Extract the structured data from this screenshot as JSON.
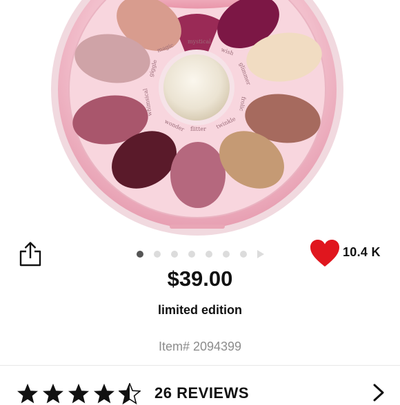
{
  "product": {
    "price": "$39.00",
    "edition": "limited edition",
    "item_number": "Item# 2094399",
    "likes": "10.4 K",
    "reviews": "26 REVIEWS",
    "rating": 4.5,
    "rating_max": 5
  },
  "gallery": {
    "total_images": 7,
    "current_index": 1
  },
  "palette": {
    "shade_names": [
      "magic",
      "mystical",
      "wish",
      "giggle",
      "glimmer",
      "whimsical",
      "frolic",
      "wonder",
      "flitter",
      "twinkle"
    ]
  },
  "colors": {
    "heart": "#e0161e",
    "accent_text": "#111111",
    "muted_text": "#8c8c8c",
    "case_pink": "#f3c4cf"
  },
  "icons": {
    "share": "share-icon",
    "heart": "heart-icon",
    "star": "star-icon",
    "chevron": "chevron-right-icon"
  }
}
